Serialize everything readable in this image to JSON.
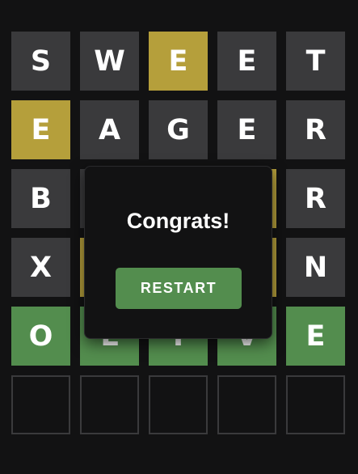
{
  "board": {
    "rows": [
      [
        {
          "letter": "S",
          "state": "absent"
        },
        {
          "letter": "W",
          "state": "absent"
        },
        {
          "letter": "E",
          "state": "present"
        },
        {
          "letter": "E",
          "state": "absent"
        },
        {
          "letter": "T",
          "state": "absent"
        }
      ],
      [
        {
          "letter": "E",
          "state": "present"
        },
        {
          "letter": "A",
          "state": "absent"
        },
        {
          "letter": "G",
          "state": "absent"
        },
        {
          "letter": "E",
          "state": "absent"
        },
        {
          "letter": "R",
          "state": "absent"
        }
      ],
      [
        {
          "letter": "B",
          "state": "absent"
        },
        {
          "letter": "",
          "state": "absent"
        },
        {
          "letter": "",
          "state": "absent"
        },
        {
          "letter": "",
          "state": "present"
        },
        {
          "letter": "R",
          "state": "absent"
        }
      ],
      [
        {
          "letter": "X",
          "state": "absent"
        },
        {
          "letter": "",
          "state": "present"
        },
        {
          "letter": "",
          "state": "absent"
        },
        {
          "letter": "",
          "state": "present"
        },
        {
          "letter": "N",
          "state": "absent"
        }
      ],
      [
        {
          "letter": "O",
          "state": "correct"
        },
        {
          "letter": "L",
          "state": "correct"
        },
        {
          "letter": "I",
          "state": "correct"
        },
        {
          "letter": "V",
          "state": "correct"
        },
        {
          "letter": "E",
          "state": "correct"
        }
      ],
      [
        {
          "letter": "",
          "state": "empty"
        },
        {
          "letter": "",
          "state": "empty"
        },
        {
          "letter": "",
          "state": "empty"
        },
        {
          "letter": "",
          "state": "empty"
        },
        {
          "letter": "",
          "state": "empty"
        }
      ]
    ]
  },
  "modal": {
    "title": "Congrats!",
    "restart_label": "RESTART"
  },
  "colors": {
    "background": "#121213",
    "absent": "#3a3a3c",
    "present": "#b59f3b",
    "correct": "#538d4e"
  }
}
